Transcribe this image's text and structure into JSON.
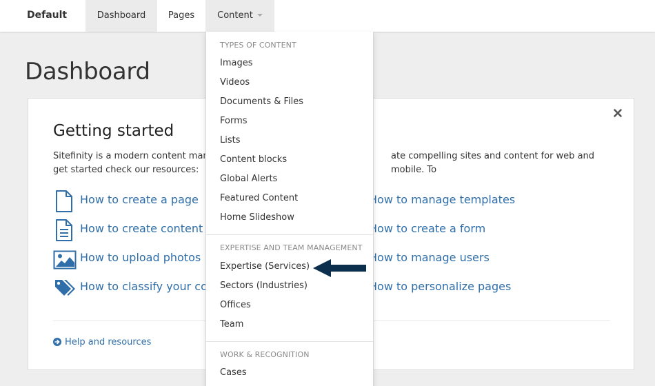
{
  "topbar": {
    "brand": "Default",
    "tabs": [
      {
        "label": "Dashboard"
      },
      {
        "label": "Pages"
      },
      {
        "label": "Content"
      }
    ]
  },
  "page": {
    "title": "Dashboard"
  },
  "card": {
    "title": "Getting started",
    "intro_left": "Sitefinity is a modern content manag",
    "intro_right": "ate compelling sites and content for web and mobile. To",
    "intro_line2": "get started check our resources:",
    "links_left": [
      {
        "label": "How to create a page",
        "icon": "page-icon"
      },
      {
        "label": "How to create content",
        "icon": "document-icon"
      },
      {
        "label": "How to upload photos",
        "icon": "image-icon"
      },
      {
        "label": "How to classify your cont",
        "icon": "tag-icon"
      }
    ],
    "links_right": [
      {
        "label": "How to manage templates"
      },
      {
        "label": "How to create a form"
      },
      {
        "label": "How to manage users"
      },
      {
        "label": "How to personalize pages"
      }
    ],
    "help": {
      "label": "Help and resources",
      "icon": "arrow-circle-right-icon"
    },
    "close_icon": "close-icon"
  },
  "dropdown": {
    "sections": [
      {
        "header": "TYPES OF CONTENT",
        "items": [
          "Images",
          "Videos",
          "Documents & Files",
          "Forms",
          "Lists",
          "Content blocks",
          "Global Alerts",
          "Featured Content",
          "Home Slideshow"
        ]
      },
      {
        "header": "EXPERTISE AND TEAM MANAGEMENT",
        "items": [
          "Expertise (Services)",
          "Sectors (Industries)",
          "Offices",
          "Team"
        ]
      },
      {
        "header": "WORK & RECOGNITION",
        "items": [
          "Cases"
        ]
      }
    ]
  },
  "colors": {
    "link": "#2f6ea8",
    "arrow": "#0b2f4c",
    "background": "#eeeeee"
  }
}
